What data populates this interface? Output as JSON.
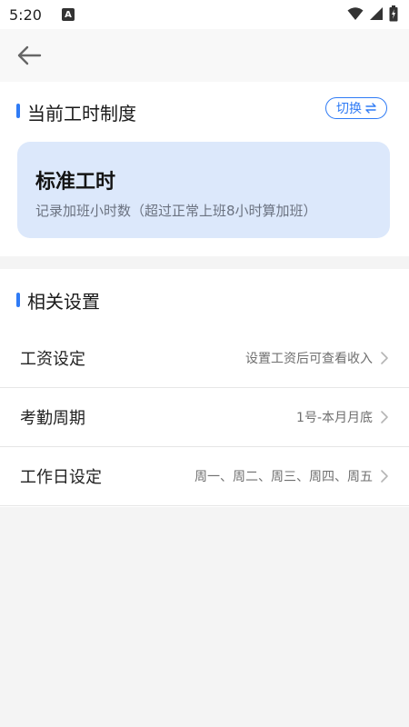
{
  "status_bar": {
    "time": "5:20",
    "notification_badge": "A"
  },
  "nav": {
    "back_icon": "back-arrow-icon"
  },
  "current_section": {
    "title": "当前工时制度",
    "switch_label": "切换"
  },
  "mode_card": {
    "title": "标准工时",
    "description": "记录加班小时数（超过正常上班8小时算加班）"
  },
  "settings_section": {
    "title": "相关设置",
    "rows": [
      {
        "label": "工资设定",
        "value": "设置工资后可查看收入"
      },
      {
        "label": "考勤周期",
        "value": "1号-本月月底"
      },
      {
        "label": "工作日设定",
        "value": "周一、周二、周三、周四、周五"
      }
    ]
  },
  "colors": {
    "accent": "#2f7bf5",
    "card_bg": "#dce8fb",
    "page_bg": "#f4f4f4"
  }
}
